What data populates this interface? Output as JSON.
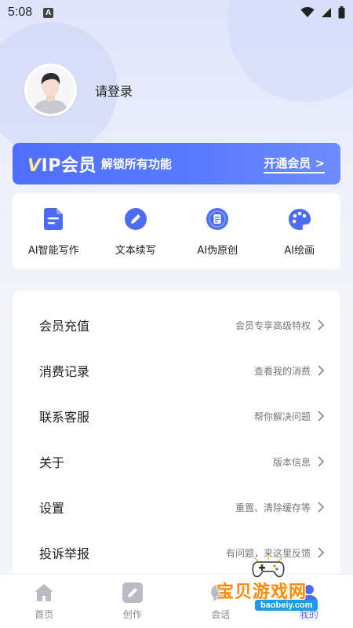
{
  "status_bar": {
    "time": "5:08",
    "a_badge": "A"
  },
  "profile": {
    "login_text": "请登录"
  },
  "vip_banner": {
    "vip_v": "V",
    "vip_rest": "IP会员",
    "subtitle": "解锁所有功能",
    "cta": "开通会员 >"
  },
  "features": [
    {
      "label": "AI智能写作",
      "icon": "document-icon"
    },
    {
      "label": "文本续写",
      "icon": "pencil-icon"
    },
    {
      "label": "AI伪原创",
      "icon": "article-icon"
    },
    {
      "label": "AI绘画",
      "icon": "palette-icon"
    }
  ],
  "menu": [
    {
      "title": "会员充值",
      "hint": "会员专享高级特权"
    },
    {
      "title": "消费记录",
      "hint": "查看我的消费"
    },
    {
      "title": "联系客服",
      "hint": "帮你解决问题"
    },
    {
      "title": "关于",
      "hint": "版本信息"
    },
    {
      "title": "设置",
      "hint": "重置、清除缓存等"
    },
    {
      "title": "投诉举报",
      "hint": "有问题，来这里反馈"
    }
  ],
  "bottom_nav": [
    {
      "label": "首页",
      "icon": "home-icon"
    },
    {
      "label": "创作",
      "icon": "edit-icon"
    },
    {
      "label": "会话",
      "icon": "chat-icon"
    },
    {
      "label": "我的",
      "icon": "profile-icon"
    }
  ],
  "watermark": {
    "text": "宝贝游戏网",
    "url": "baobeiy.com"
  },
  "colors": {
    "accent": "#4d6cf6",
    "vip_gold": "#ffe79a",
    "watermark_orange": "#ff8a00"
  }
}
